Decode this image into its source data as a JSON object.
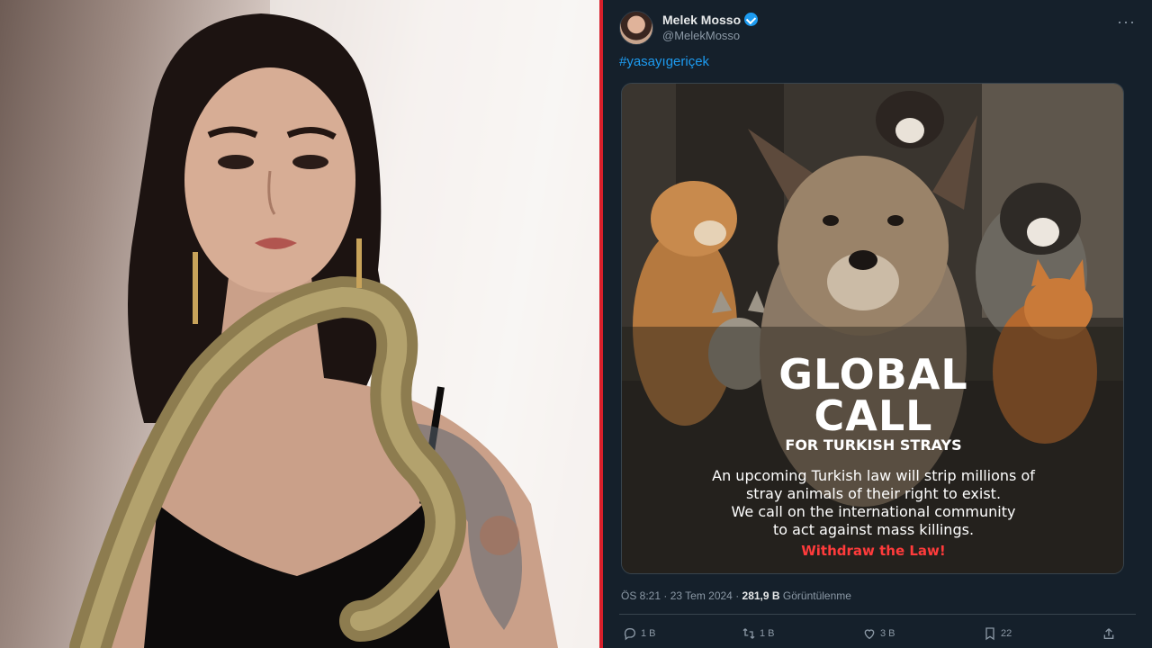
{
  "tweet": {
    "author_name": "Melek Mosso",
    "author_handle": "@MelekMosso",
    "hashtag": "#yasayıgeriçek",
    "media": {
      "title_line1": "GLOBAL",
      "title_line2": "CALL",
      "subtitle": "FOR TURKISH STRAYS",
      "body_lines": [
        "An upcoming Turkish law will strip millions of",
        "stray animals of their right to exist.",
        "We call on the international community",
        "to act against mass killings."
      ],
      "cta": "Withdraw the Law!"
    },
    "timestamp": "ÖS 8:21 · 23 Tem 2024 ·",
    "views_count": "281,9 B",
    "views_label": "Görüntülenme",
    "actions": {
      "reply_count": "1 B",
      "retweet_count": "1 B",
      "like_count": "3 B",
      "bookmark_count": "22"
    }
  },
  "colors": {
    "tweet_bg": "#15202b",
    "accent": "#1d9bf0",
    "divider": "#d71f2a",
    "cta": "#ff3b3b"
  },
  "icons": [
    "verified-badge-icon",
    "more-icon",
    "reply-icon",
    "retweet-icon",
    "like-icon",
    "bookmark-icon",
    "share-icon"
  ]
}
